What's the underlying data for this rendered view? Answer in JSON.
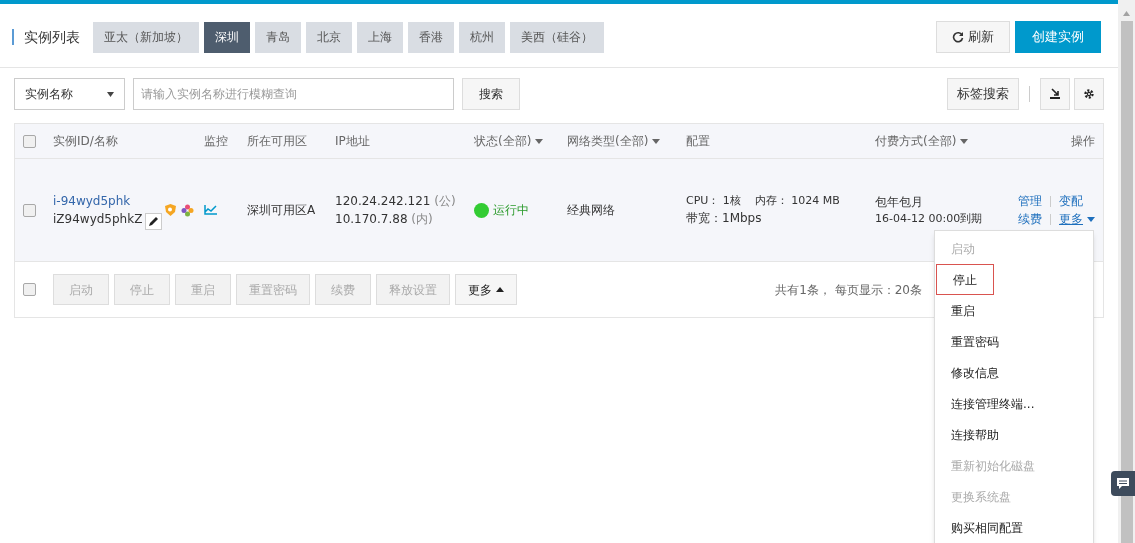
{
  "title": "实例列表",
  "regions": [
    {
      "label": "亚太（新加坡）",
      "selected": false
    },
    {
      "label": "深圳",
      "selected": true
    },
    {
      "label": "青岛",
      "selected": false
    },
    {
      "label": "北京",
      "selected": false
    },
    {
      "label": "上海",
      "selected": false
    },
    {
      "label": "香港",
      "selected": false
    },
    {
      "label": "杭州",
      "selected": false
    },
    {
      "label": "美西（硅谷）",
      "selected": false
    }
  ],
  "refresh_button": "刷新",
  "create_button": "创建实例",
  "filter": {
    "select": "实例名称",
    "placeholder": "请输入实例名称进行模糊查询",
    "search_button": "搜索",
    "tag_search_button": "标签搜索"
  },
  "table": {
    "header_checked": false,
    "columns": [
      {
        "label": "实例ID/名称",
        "filter": false
      },
      {
        "label": "监控",
        "filter": false
      },
      {
        "label": "所在可用区",
        "filter": false
      },
      {
        "label": "IP地址",
        "filter": false
      },
      {
        "label": "状态(全部)",
        "filter": true
      },
      {
        "label": "网络类型(全部)",
        "filter": true
      },
      {
        "label": "配置",
        "filter": false
      },
      {
        "label": "付费方式(全部)",
        "filter": true
      },
      {
        "label": "操作",
        "filter": false
      }
    ],
    "rows": [
      {
        "checked": false,
        "id": "i-94wyd5phk",
        "name": "iZ94wyd5phkZ",
        "zone": "深圳可用区A",
        "ip_public": "120.24.242.121",
        "ip_public_tag": "(公)",
        "ip_private": "10.170.7.88",
        "ip_private_tag": "(内)",
        "status": "运行中",
        "color": "#33cc33",
        "network": "经典网络",
        "config_line1": "CPU： 1核    内存： 1024 MB",
        "config_line2": "带宽：1Mbps",
        "billing": "包年包月",
        "expiry": "16-04-12 00:00到期",
        "actions": [
          "管理",
          "变配",
          "续费",
          "更多"
        ]
      }
    ]
  },
  "footer": {
    "checked": false,
    "buttons": [
      {
        "label": "启动",
        "disabled": true
      },
      {
        "label": "停止",
        "disabled": true
      },
      {
        "label": "重启",
        "disabled": true
      },
      {
        "label": "重置密码",
        "disabled": true
      },
      {
        "label": "续费",
        "disabled": true
      },
      {
        "label": "释放设置",
        "disabled": true
      },
      {
        "label": "更多",
        "disabled": false
      }
    ],
    "summary": "共有1条， 每页显示：20条"
  },
  "more_menu": [
    {
      "label": "启动",
      "disabled": true,
      "selected": false
    },
    {
      "label": "停止",
      "disabled": false,
      "selected": true
    },
    {
      "label": "重启",
      "disabled": false,
      "selected": false
    },
    {
      "label": "重置密码",
      "disabled": false,
      "selected": false
    },
    {
      "label": "修改信息",
      "disabled": false,
      "selected": false
    },
    {
      "label": "连接管理终端...",
      "disabled": false,
      "selected": false
    },
    {
      "label": "连接帮助",
      "disabled": false,
      "selected": false
    },
    {
      "label": "重新初始化磁盘",
      "disabled": true,
      "selected": false
    },
    {
      "label": "更换系统盘",
      "disabled": true,
      "selected": false
    },
    {
      "label": "购买相同配置",
      "disabled": false,
      "selected": false
    }
  ]
}
